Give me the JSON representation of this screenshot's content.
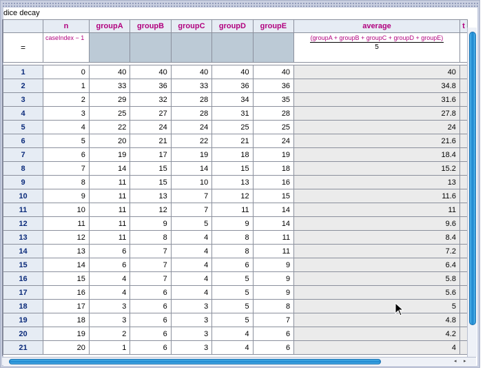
{
  "window": {
    "title": "dice decay"
  },
  "columns": {
    "n": "n",
    "groupA": "groupA",
    "groupB": "groupB",
    "groupC": "groupC",
    "groupD": "groupD",
    "groupE": "groupE",
    "average": "average",
    "cut_off": "t"
  },
  "formulas": {
    "row_label": "=",
    "n": "caseIndex − 1",
    "average_numerator": "(groupA + groupB + groupC + groupD + groupE)",
    "average_denominator": "5"
  },
  "rows": [
    {
      "idx": "1",
      "n": "0",
      "a": "40",
      "b": "40",
      "c": "40",
      "d": "40",
      "e": "40",
      "avg": "40"
    },
    {
      "idx": "2",
      "n": "1",
      "a": "33",
      "b": "36",
      "c": "33",
      "d": "36",
      "e": "36",
      "avg": "34.8"
    },
    {
      "idx": "3",
      "n": "2",
      "a": "29",
      "b": "32",
      "c": "28",
      "d": "34",
      "e": "35",
      "avg": "31.6"
    },
    {
      "idx": "4",
      "n": "3",
      "a": "25",
      "b": "27",
      "c": "28",
      "d": "31",
      "e": "28",
      "avg": "27.8"
    },
    {
      "idx": "5",
      "n": "4",
      "a": "22",
      "b": "24",
      "c": "24",
      "d": "25",
      "e": "25",
      "avg": "24"
    },
    {
      "idx": "6",
      "n": "5",
      "a": "20",
      "b": "21",
      "c": "22",
      "d": "21",
      "e": "24",
      "avg": "21.6"
    },
    {
      "idx": "7",
      "n": "6",
      "a": "19",
      "b": "17",
      "c": "19",
      "d": "18",
      "e": "19",
      "avg": "18.4"
    },
    {
      "idx": "8",
      "n": "7",
      "a": "14",
      "b": "15",
      "c": "14",
      "d": "15",
      "e": "18",
      "avg": "15.2"
    },
    {
      "idx": "9",
      "n": "8",
      "a": "11",
      "b": "15",
      "c": "10",
      "d": "13",
      "e": "16",
      "avg": "13"
    },
    {
      "idx": "10",
      "n": "9",
      "a": "11",
      "b": "13",
      "c": "7",
      "d": "12",
      "e": "15",
      "avg": "11.6"
    },
    {
      "idx": "11",
      "n": "10",
      "a": "11",
      "b": "12",
      "c": "7",
      "d": "11",
      "e": "14",
      "avg": "11"
    },
    {
      "idx": "12",
      "n": "11",
      "a": "11",
      "b": "9",
      "c": "5",
      "d": "9",
      "e": "14",
      "avg": "9.6"
    },
    {
      "idx": "13",
      "n": "12",
      "a": "11",
      "b": "8",
      "c": "4",
      "d": "8",
      "e": "11",
      "avg": "8.4"
    },
    {
      "idx": "14",
      "n": "13",
      "a": "6",
      "b": "7",
      "c": "4",
      "d": "8",
      "e": "11",
      "avg": "7.2"
    },
    {
      "idx": "15",
      "n": "14",
      "a": "6",
      "b": "7",
      "c": "4",
      "d": "6",
      "e": "9",
      "avg": "6.4"
    },
    {
      "idx": "16",
      "n": "15",
      "a": "4",
      "b": "7",
      "c": "4",
      "d": "5",
      "e": "9",
      "avg": "5.8"
    },
    {
      "idx": "17",
      "n": "16",
      "a": "4",
      "b": "6",
      "c": "4",
      "d": "5",
      "e": "9",
      "avg": "5.6"
    },
    {
      "idx": "18",
      "n": "17",
      "a": "3",
      "b": "6",
      "c": "3",
      "d": "5",
      "e": "8",
      "avg": "5"
    },
    {
      "idx": "19",
      "n": "18",
      "a": "3",
      "b": "6",
      "c": "3",
      "d": "5",
      "e": "7",
      "avg": "4.8"
    },
    {
      "idx": "20",
      "n": "19",
      "a": "2",
      "b": "6",
      "c": "3",
      "d": "4",
      "e": "6",
      "avg": "4.2"
    },
    {
      "idx": "21",
      "n": "20",
      "a": "1",
      "b": "6",
      "c": "3",
      "d": "4",
      "e": "6",
      "avg": "4"
    }
  ],
  "scrollbars": {
    "left_arrow": "◂",
    "right_arrow": "▸"
  },
  "icons": {
    "cursor": "arrow-cursor-icon"
  },
  "colors": {
    "header_text": "#b1007e",
    "row_number_text": "#0a2a7a",
    "scroll_thumb": "#1c86cf"
  }
}
